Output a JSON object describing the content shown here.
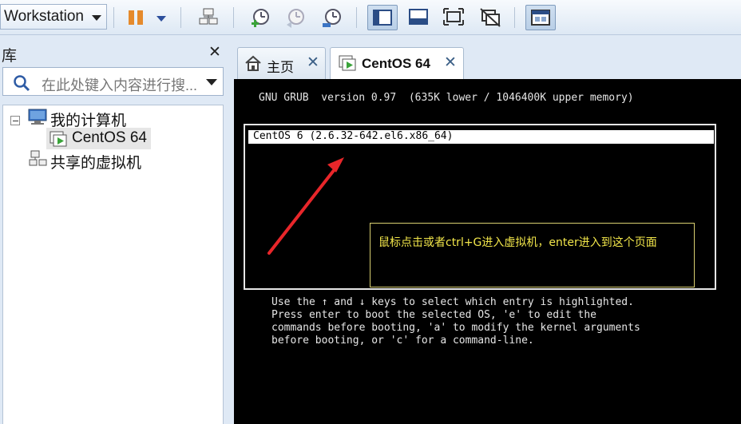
{
  "toolbar": {
    "workstation_label": "Workstation",
    "buttons": [
      {
        "icon": "pause-icon"
      },
      {
        "icon": "pause-dropdown-icon"
      },
      {
        "icon": "network-icon"
      },
      {
        "icon": "snapshot-take-icon"
      },
      {
        "icon": "snapshot-revert-icon"
      },
      {
        "icon": "snapshot-manager-icon"
      },
      {
        "icon": "library-view-icon"
      },
      {
        "icon": "console-view-icon"
      },
      {
        "icon": "fullscreen-icon"
      },
      {
        "icon": "unity-icon"
      },
      {
        "icon": "thumbnail-view-icon"
      }
    ]
  },
  "library": {
    "title": "库",
    "close_label": "✕",
    "search_placeholder": "在此处键入内容进行搜...",
    "tree": {
      "my_computer": "我的计算机",
      "vm": "CentOS 64",
      "shared": "共享的虚拟机"
    }
  },
  "tabs": [
    {
      "label": "主页",
      "icon": "home-icon"
    },
    {
      "label": "CentOS 64",
      "icon": "vm-icon"
    }
  ],
  "console": {
    "header": "GNU GRUB  version 0.97  (635K lower / 1046400K upper memory)",
    "entry": "CentOS 6 (2.6.32-642.el6.x86_64)",
    "annotation": "鼠标点击或者ctrl+G进入虚拟机，enter进入到这个页面",
    "help_lines": [
      "Use the ↑ and ↓ keys to select which entry is highlighted.",
      "Press enter to boot the selected OS, 'e' to edit the",
      "commands before booting, 'a' to modify the kernel arguments",
      "before booting, or 'c' for a command-line."
    ]
  },
  "colors": {
    "annotation_text": "#f2e64a",
    "arrow": "#e8262a",
    "console_bg": "#000000",
    "toolbar_bg": "#dfe9f5"
  }
}
